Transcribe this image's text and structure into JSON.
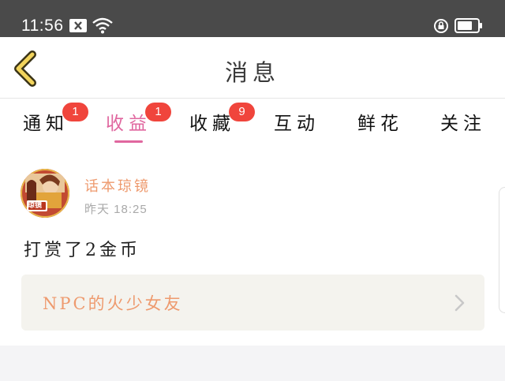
{
  "status_bar": {
    "time": "11:56",
    "icons": [
      "notification-x-icon",
      "wifi-icon",
      "rotation-lock-icon",
      "battery-icon"
    ]
  },
  "header": {
    "title": "消息",
    "back_icon": "chevron-left-icon",
    "accent_color": "#e0679f"
  },
  "tabs": [
    {
      "label": "通知",
      "badge": "1"
    },
    {
      "label": "收益",
      "badge": "1",
      "active": true
    },
    {
      "label": "收藏",
      "badge": "9"
    },
    {
      "label": "互动",
      "badge": ""
    },
    {
      "label": "鲜花",
      "badge": ""
    },
    {
      "label": "关注",
      "badge": ""
    }
  ],
  "message": {
    "username": "话本琼镜",
    "time": "昨天 18:25",
    "text": "打赏了2金币",
    "avatar_label": "琼镜",
    "reference": {
      "title": "NPC的火少女友",
      "chevron_icon": "chevron-right-icon"
    }
  }
}
